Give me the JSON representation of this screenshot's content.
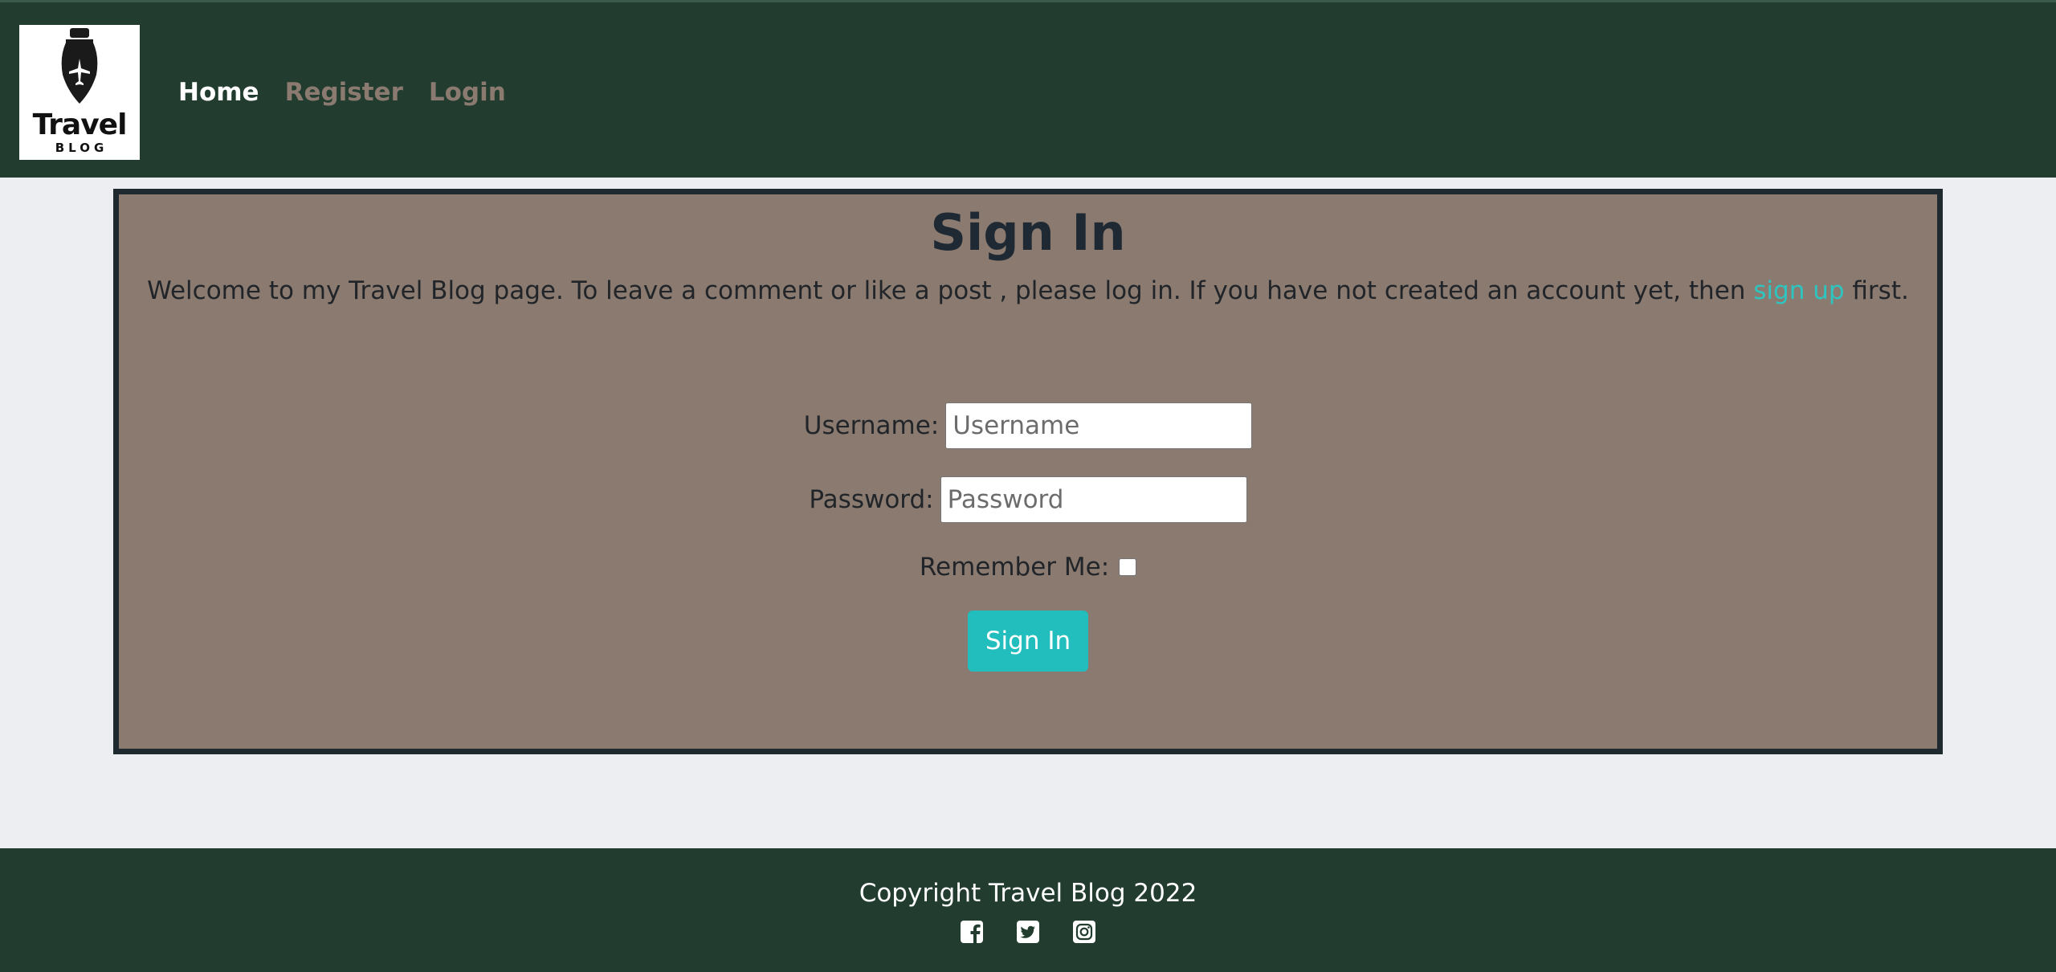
{
  "navbar": {
    "logo": {
      "title": "Travel",
      "subtitle": "BLOG"
    },
    "links": [
      {
        "label": "Home",
        "active": true
      },
      {
        "label": "Register",
        "active": false
      },
      {
        "label": "Login",
        "active": false
      }
    ]
  },
  "signin": {
    "title": "Sign In",
    "intro_before": "Welcome to my Travel Blog page. To leave a comment or like a post , please log in. If you have not created an account yet, then ",
    "intro_link": "sign up",
    "intro_after": " first.",
    "username_label": "Username:",
    "username_placeholder": "Username",
    "username_value": "",
    "password_label": "Password:",
    "password_placeholder": "Password",
    "password_value": "",
    "remember_label": "Remember Me:",
    "remember_checked": false,
    "button_label": "Sign In"
  },
  "footer": {
    "copyright": "Copyright Travel Blog 2022",
    "socials": [
      "facebook-icon",
      "twitter-icon",
      "instagram-icon"
    ]
  },
  "colors": {
    "nav_bg": "#223d30",
    "card_bg": "#8a7a6f",
    "accent": "#22bdbd",
    "page_bg": "#edeef2"
  }
}
